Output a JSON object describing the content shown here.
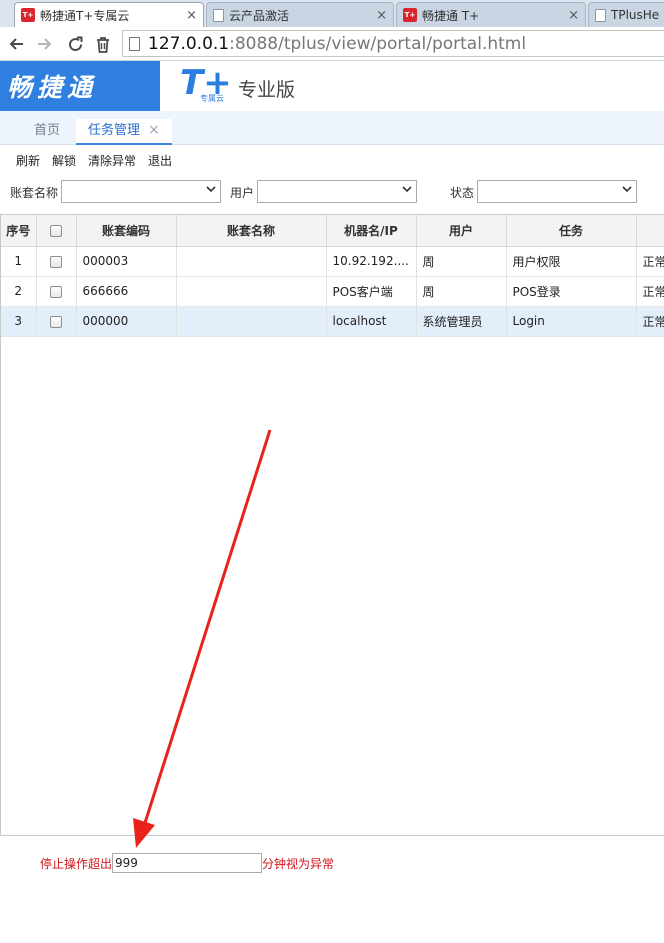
{
  "browser": {
    "tabs": [
      {
        "title": "畅捷通T+专属云",
        "favicon": "T+",
        "active": true
      },
      {
        "title": "云产品激活",
        "favicon": "doc",
        "active": false
      },
      {
        "title": "畅捷通 T+",
        "favicon": "T+",
        "active": false
      },
      {
        "title": "TPlusHe",
        "favicon": "doc",
        "active": false
      }
    ],
    "close_glyph": "×",
    "url_host": "127.0.0.1",
    "url_path": ":8088/tplus/view/portal/portal.html",
    "icons": {
      "back": "arrow-left-icon",
      "forward": "arrow-right-icon",
      "reload": "reload-icon",
      "clear": "trash-icon"
    }
  },
  "header": {
    "brand": "畅捷通",
    "logo_letter": "T+",
    "logo_sub": "专属云",
    "edition": "专业版",
    "brand_color": "#2f7fe0"
  },
  "app_tabs": [
    {
      "label": "首页",
      "active": false
    },
    {
      "label": "任务管理",
      "active": true
    }
  ],
  "toolbar": {
    "refresh": "刷新",
    "unlock": "解锁",
    "clear_exceptions": "清除异常",
    "logout": "退出"
  },
  "filters": {
    "account_name_label": "账套名称",
    "account_name_value": "",
    "user_label": "用户",
    "user_value": "",
    "status_label": "状态",
    "status_value": ""
  },
  "grid": {
    "columns": [
      "序号",
      "",
      "账套编码",
      "账套名称",
      "机器名/IP",
      "用户",
      "任务",
      ""
    ],
    "rows": [
      {
        "no": "1",
        "code": "000003",
        "name": "",
        "machine": "10.92.192....",
        "user": "周",
        "task": "用户权限",
        "status": "正常"
      },
      {
        "no": "2",
        "code": "666666",
        "name": "",
        "machine": "POS客户端",
        "user": "周",
        "task": "POS登录",
        "status": "正常"
      },
      {
        "no": "3",
        "code": "000000",
        "name": "",
        "machine": "localhost",
        "user": "系统管理员",
        "task": "Login",
        "status": "正常",
        "selected": true
      }
    ]
  },
  "timeout": {
    "prefix": "停止操作超出",
    "value": "999",
    "suffix": "分钟视为异常",
    "color": "#d0161b"
  },
  "annotation": {
    "arrow_color": "#e8231c"
  }
}
